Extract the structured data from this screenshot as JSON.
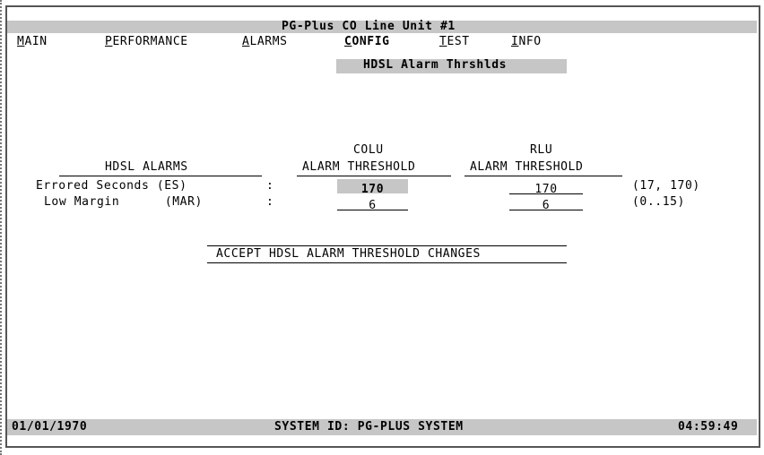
{
  "window": {
    "title": "PG-Plus CO Line Unit #1"
  },
  "menu": {
    "items": [
      {
        "label": "MAIN",
        "hotkey": "M",
        "rest": "AIN"
      },
      {
        "label": "PERFORMANCE",
        "hotkey": "P",
        "rest": "ERFORMANCE"
      },
      {
        "label": "ALARMS",
        "hotkey": "A",
        "rest": "LARMS"
      },
      {
        "label": "CONFIG",
        "hotkey": "C",
        "rest": "ONFIG"
      },
      {
        "label": "TEST",
        "hotkey": "T",
        "rest": "EST"
      },
      {
        "label": "INFO",
        "hotkey": "I",
        "rest": "NFO"
      }
    ],
    "active": "CONFIG",
    "submenu_label": "HDSL Alarm Thrshlds"
  },
  "table": {
    "col1_header": "HDSL ALARMS",
    "col2_header_top": "COLU",
    "col2_header_bottom": "ALARM THRESHOLD",
    "col3_header_top": "RLU",
    "col3_header_bottom": "ALARM THRESHOLD",
    "rows": [
      {
        "name": "Errored Seconds (ES)",
        "sep": ":",
        "colu": "170",
        "rlu": "170",
        "range": "(17, 170)"
      },
      {
        "name": "Low Margin      (MAR)",
        "sep": ":",
        "colu": "6",
        "rlu": "6",
        "range": "(0..15)"
      }
    ]
  },
  "accept_button": {
    "label": "ACCEPT HDSL ALARM THRESHOLD CHANGES"
  },
  "status": {
    "date": "01/01/1970",
    "system_id": "SYSTEM ID: PG-PLUS SYSTEM",
    "time": "04:59:49"
  },
  "colors": {
    "highlight_gray": "#c6c6c6",
    "text": "#000000"
  }
}
